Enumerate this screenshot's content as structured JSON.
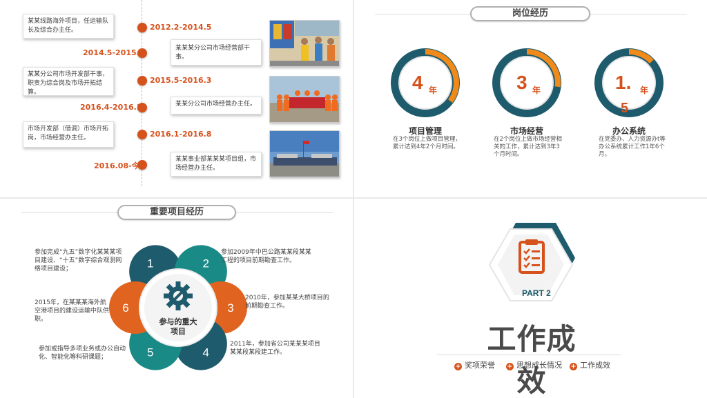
{
  "timeline": {
    "entries": [
      {
        "date": "2012.2-2014.5",
        "desc": "某某线路海外项目，任运输队长及综合办主任。"
      },
      {
        "date": "2014.5-2015.4",
        "desc": "某某某分公司市场经营部干事。"
      },
      {
        "date": "2015.5-2016.3",
        "desc": "某某分公司市场开发部干事，职责为综合岗及市场开拓结算。"
      },
      {
        "date": "2016.4-2016.1",
        "desc": "某某分公司市场经营办主任。"
      },
      {
        "date": "2016.1-2016.8",
        "desc": "市场开发部（借调）市场开拓岗，市场经营办主任。"
      },
      {
        "date": "2016.08-今",
        "desc": "某某事业部某某某项目组，市场经营办主任。"
      }
    ]
  },
  "positions": {
    "title": "岗位经历",
    "items": [
      {
        "num": "4",
        "unit": "年",
        "title": "项目管理",
        "desc": "在3个岗位上做项目管理，累计达到4年2个月时间。",
        "fraction": 0.35
      },
      {
        "num": "3",
        "unit": "年",
        "title": "市场经营",
        "desc": "在2个岗位上做市场经营相关的工作，累计达到3年3个月时间。",
        "fraction": 0.27
      },
      {
        "num": "1.",
        "unit": "年",
        "extra": "5",
        "title": "办公系统",
        "desc": "在党委办、人力资源办t等办公系统累计工作1年6个月。",
        "fraction": 0.13
      }
    ]
  },
  "projects": {
    "title": "重要项目经历",
    "center_label": "参与的重大项目",
    "center_icon": "gear-wrench-icon",
    "petals": [
      {
        "num": "1",
        "color": "#1e5b6c",
        "desc": "参加完成“九五”数字化某某某项目建设、“十五”数字综合观测网络项目建设；"
      },
      {
        "num": "2",
        "color": "#1a8a86",
        "desc": "参加2009年中巴公路某某段某某工程的项目前期勘查工作。"
      },
      {
        "num": "3",
        "color": "#e0641f",
        "desc": "2010年，参加某某大桥项目的前期勘查工作。"
      },
      {
        "num": "4",
        "color": "#1e5b6c",
        "desc": "2011年，参加省公司某某某项目某某段某段建工作。"
      },
      {
        "num": "5",
        "color": "#1a8a86",
        "desc": "参加或指导多项业务或办公自动化、智能化等科研课题；"
      },
      {
        "num": "6",
        "color": "#e0641f",
        "desc": "2015年，在某某某海外航空港项目的建设运输中队供职。"
      }
    ]
  },
  "part2": {
    "label": "PART 2",
    "title": "工作成效",
    "icon": "clipboard-checklist-icon",
    "subitems": [
      "奖项荣誉",
      "思想成长情况",
      "工作成效"
    ]
  },
  "colors": {
    "orange": "#d6521d",
    "teal": "#1e5b6c",
    "teal_light": "#1a8a86"
  }
}
